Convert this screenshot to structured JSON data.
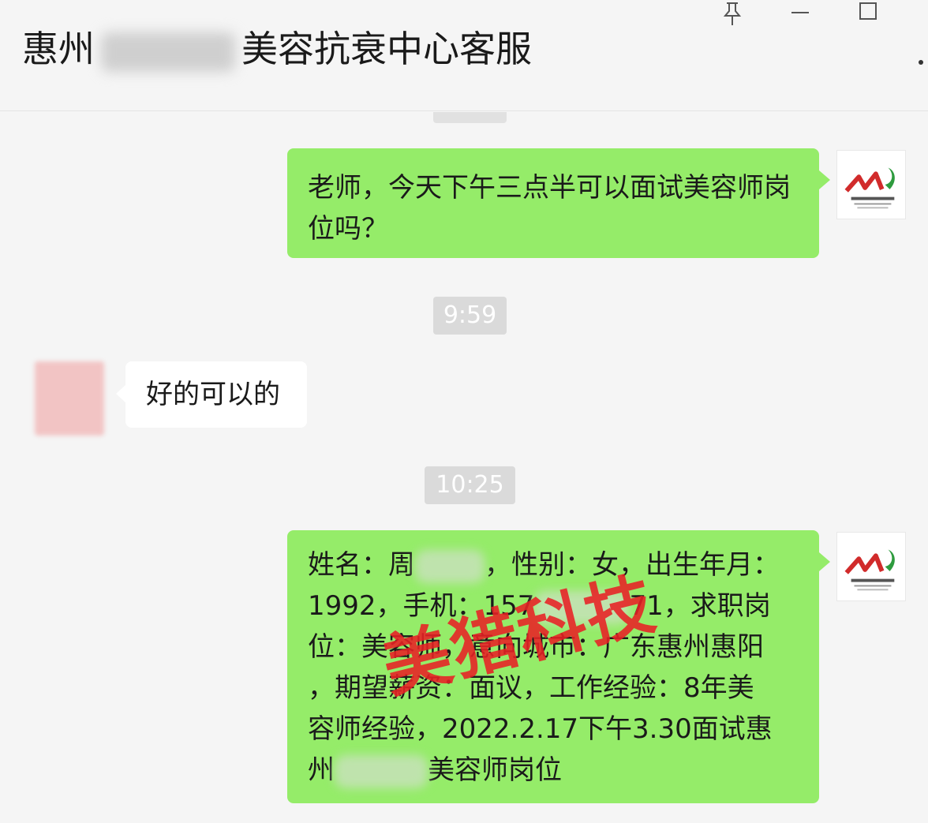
{
  "window": {
    "title_prefix": "惠州",
    "title_suffix": "美容抗衰中心客服",
    "controls": [
      "pin-icon",
      "minimize-icon",
      "maximize-icon"
    ]
  },
  "messages": [
    {
      "from": "me",
      "text": "老师，今天下午三点半可以面试美容师岗位吗？"
    },
    {
      "type": "timestamp",
      "text": "9:59"
    },
    {
      "from": "other",
      "text": "好的可以的"
    },
    {
      "type": "timestamp",
      "text": "10:25"
    },
    {
      "from": "me",
      "lines": [
        {
          "a": "姓名：周",
          "b": "，性别：女，出生年月："
        },
        {
          "a": "1992，手机：157",
          "b": "71，求职岗"
        },
        {
          "a": "位：美容师，意向城市：广东惠州惠阳"
        },
        {
          "a": "，期望薪资：面议，工作经验：8年美"
        },
        {
          "a": "容师经验，2022.2.17下午3.30面试惠"
        },
        {
          "a": "州",
          "b": "美容师岗位"
        }
      ]
    }
  ],
  "watermark": "美猎科技",
  "colors": {
    "my_bubble": "#95ec69",
    "other_bubble": "#ffffff",
    "watermark": "#e82024",
    "background": "#f5f5f5"
  }
}
